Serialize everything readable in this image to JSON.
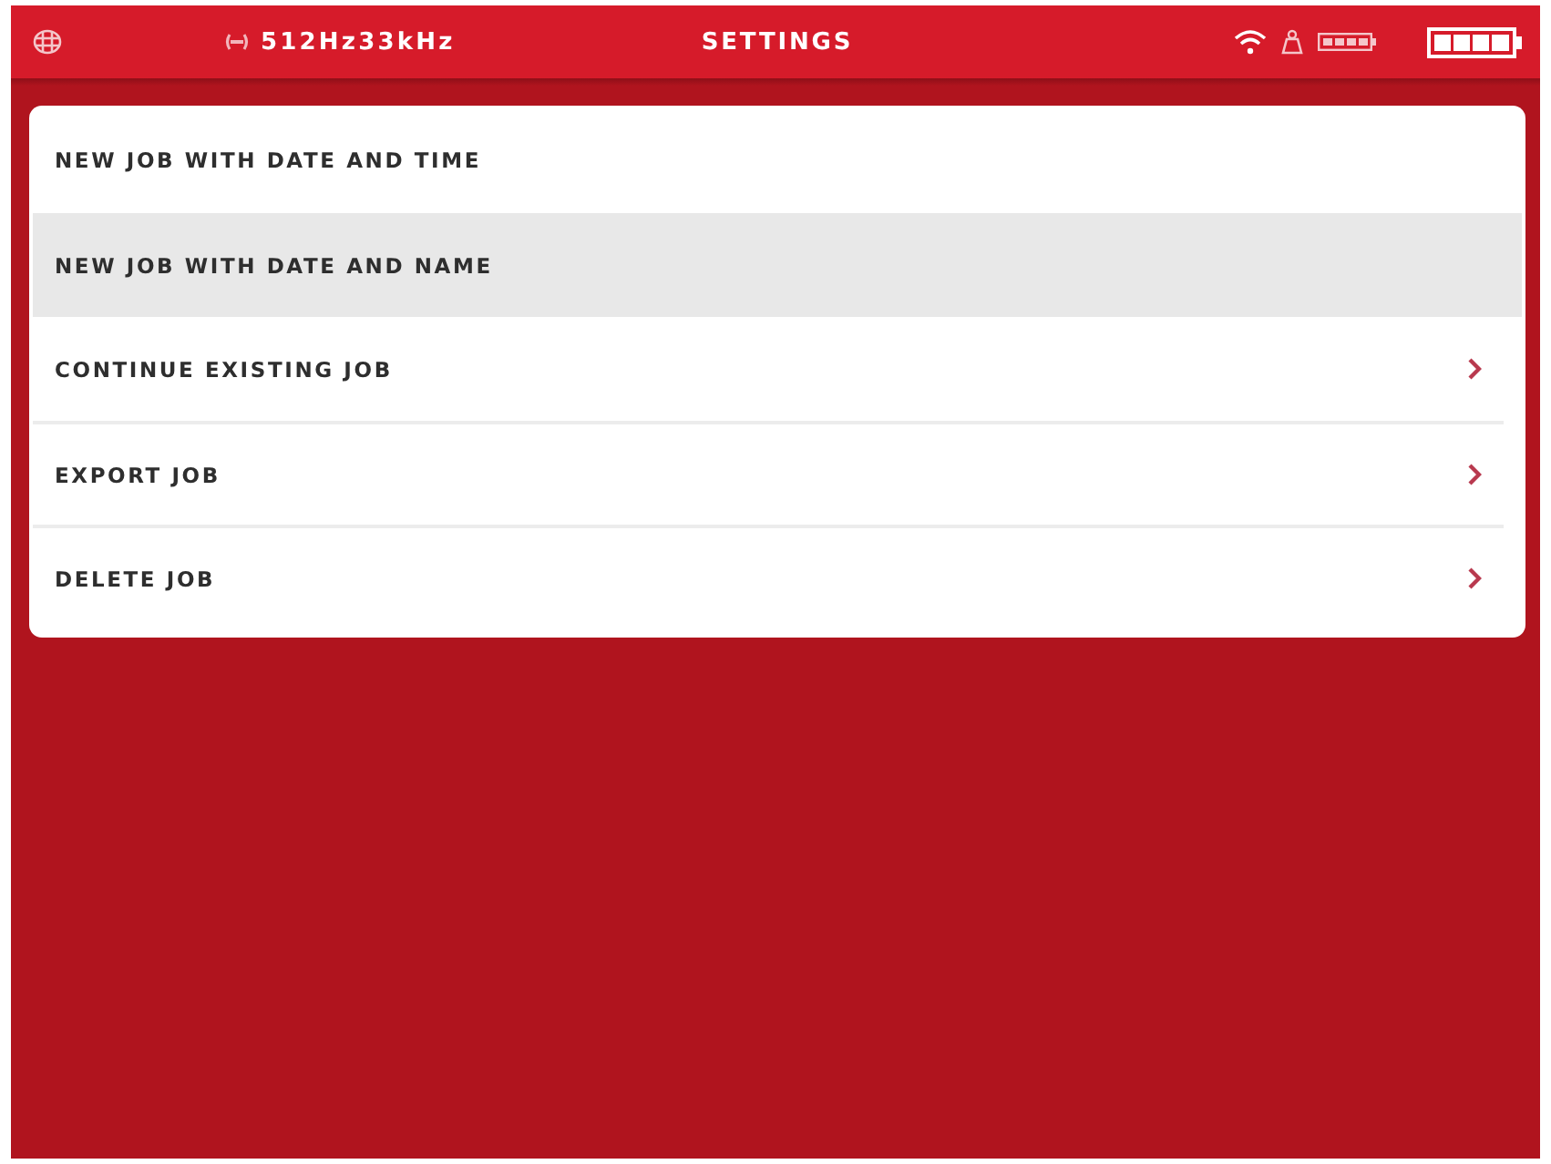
{
  "status_bar": {
    "frequency": "512Hz33kHz",
    "title": "SETTINGS"
  },
  "menu": {
    "items": [
      {
        "label": "NEW JOB WITH DATE AND TIME",
        "kind": "action",
        "selected": false
      },
      {
        "label": "NEW JOB WITH DATE AND NAME",
        "kind": "action",
        "selected": true
      },
      {
        "label": "CONTINUE EXISTING JOB",
        "kind": "submenu",
        "selected": false
      },
      {
        "label": "EXPORT JOB",
        "kind": "submenu",
        "selected": false
      },
      {
        "label": "DELETE JOB",
        "kind": "submenu",
        "selected": false
      }
    ]
  }
}
